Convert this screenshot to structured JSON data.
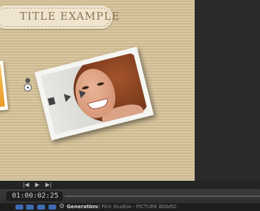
{
  "canvas": {
    "title": "TITLE EXAMPLE"
  },
  "playback": {
    "prev_icon": "skip-back-icon",
    "play_icon": "play-icon",
    "next_icon": "skip-forward-icon",
    "prev_glyph": "|◀",
    "play_glyph": "▶",
    "next_glyph": "▶|"
  },
  "timeline": {
    "timecode": "01:00:02:25"
  },
  "statusbar": {
    "icons": [
      "layout-icon",
      "viewer-icon",
      "eye-icon",
      "layers-icon"
    ],
    "gear_glyph": "⚙",
    "label": "Generators",
    "project": "Pixel Film Studios - PICTURE BOARD"
  },
  "colors": {
    "background": "#d8c7a0",
    "accent_blue": "#3d6db3"
  }
}
